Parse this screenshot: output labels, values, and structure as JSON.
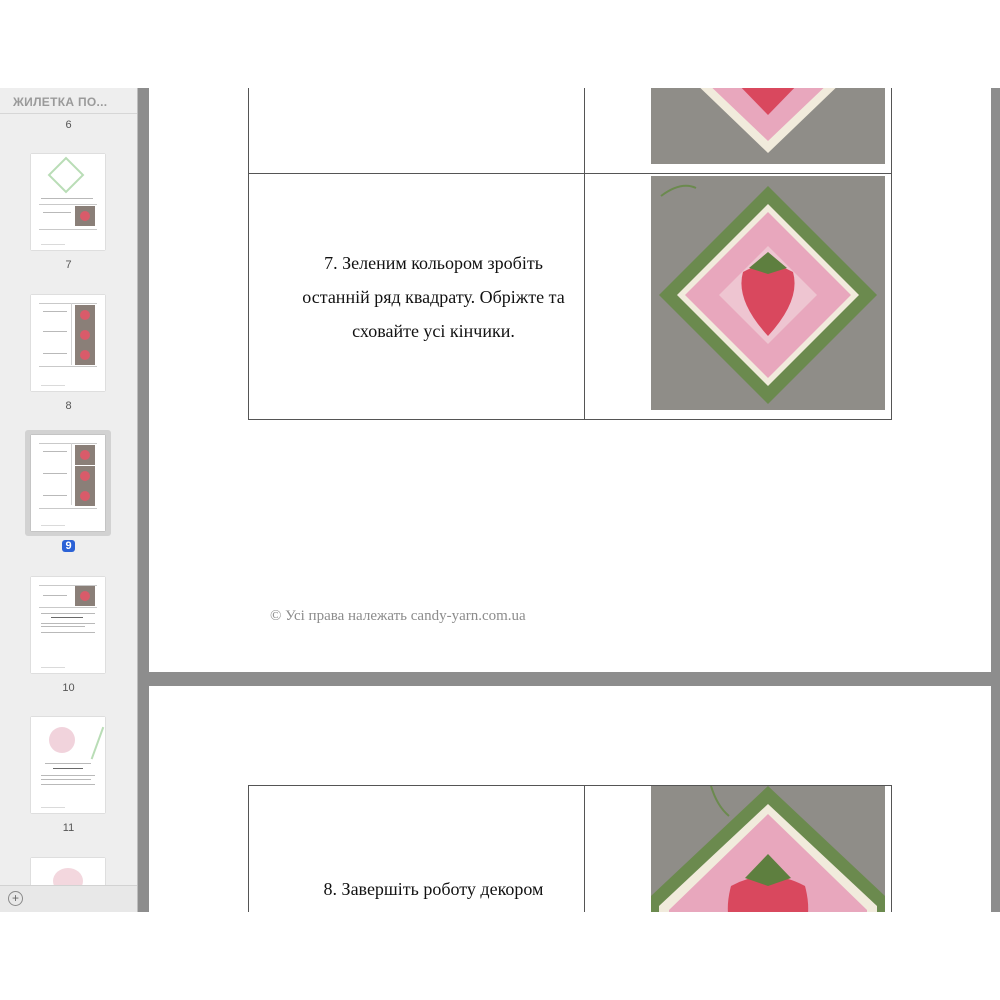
{
  "sidebar": {
    "title": "ЖИЛЕТКА ПО...",
    "page_numbers": [
      "6",
      "7",
      "8",
      "9",
      "10",
      "11"
    ],
    "selected_page": "9"
  },
  "document": {
    "step7": "7. Зеленим кольором зробіть останній ряд квадрату. Обріжте та сховайте усі кінчики.",
    "step8": "8. Завершіть роботу декором",
    "copyright": "© Усі права належать candy-yarn.com.ua"
  },
  "colors": {
    "crochet_green": "#6b8a4e",
    "crochet_pink": "#e8a7bd",
    "strawberry_red": "#d9485e",
    "selection_blue": "#2b62d6"
  },
  "icons": [
    "add-icon"
  ]
}
